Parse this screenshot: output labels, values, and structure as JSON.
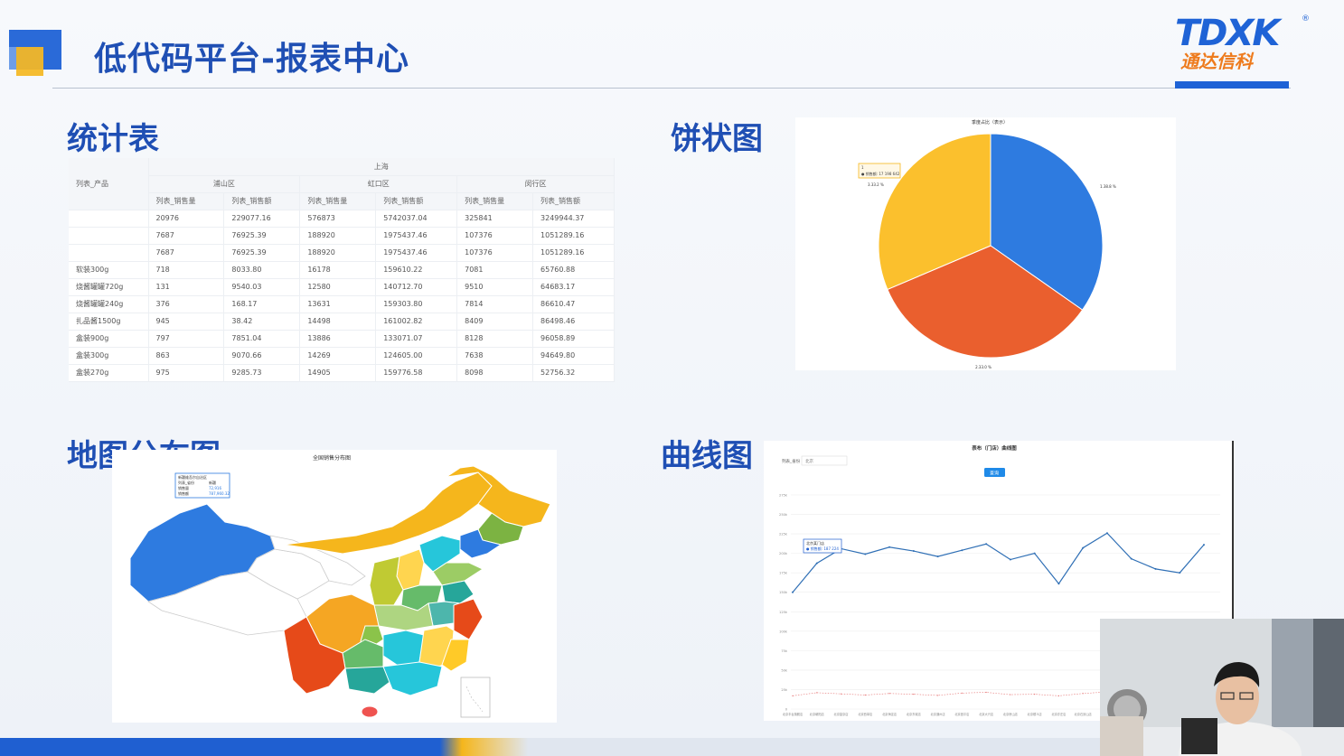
{
  "header": {
    "title": "低代码平台-报表中心",
    "logo_text": "TDXK",
    "logo_reg": "®",
    "logo_cn": "通达信科"
  },
  "sections": {
    "table_title": "统计表",
    "pie_title": "饼状图",
    "map_title": "地图分布图",
    "line_title": "曲线图"
  },
  "table": {
    "group_header": "上海",
    "row_header": "列表_产品",
    "districts": [
      "浦山区",
      "虹口区",
      "闵行区"
    ],
    "sub_headers": [
      "列表_销售量",
      "列表_销售额",
      "列表_销售量",
      "列表_销售额",
      "列表_销售量",
      "列表_销售额"
    ],
    "rows": [
      [
        "",
        "20976",
        "229077.16",
        "576873",
        "5742037.04",
        "325841",
        "3249944.37"
      ],
      [
        "",
        "7687",
        "76925.39",
        "188920",
        "1975437.46",
        "107376",
        "1051289.16"
      ],
      [
        "",
        "7687",
        "76925.39",
        "188920",
        "1975437.46",
        "107376",
        "1051289.16"
      ],
      [
        "软装300g",
        "718",
        "8033.80",
        "16178",
        "159610.22",
        "7081",
        "65760.88"
      ],
      [
        "烧酱罐罐720g",
        "131",
        "9540.03",
        "12580",
        "140712.70",
        "9510",
        "64683.17"
      ],
      [
        "烧酱罐罐240g",
        "376",
        "168.17",
        "13631",
        "159303.80",
        "7814",
        "86610.47"
      ],
      [
        "扎品酱1500g",
        "945",
        "38.42",
        "14498",
        "161002.82",
        "8409",
        "86498.46"
      ],
      [
        "盒装900g",
        "797",
        "7851.04",
        "13886",
        "133071.07",
        "8128",
        "96058.89"
      ],
      [
        "盒装300g",
        "863",
        "9070.66",
        "14269",
        "124605.00",
        "7638",
        "94649.80"
      ],
      [
        "盒装270g",
        "975",
        "9285.73",
        "14905",
        "159776.58",
        "8098",
        "52756.32"
      ]
    ]
  },
  "pie": {
    "title": "季度占比（表示）",
    "tooltip_line1": "1",
    "tooltip_line2": "● 销售额: 17 198 642",
    "labels": [
      "1.38.8 %",
      "2.33.0 %",
      "3.33.2 %"
    ],
    "colors": [
      "#2e7be0",
      "#ea5f2e",
      "#fbc02d"
    ]
  },
  "map": {
    "title": "全国销售分布图",
    "tooltip": {
      "title": "新疆维吾尔自治区",
      "rows": [
        [
          "列表_省份",
          "新疆"
        ],
        [
          "销售量",
          "72,916"
        ],
        [
          "销售额",
          "787,960.32"
        ]
      ]
    }
  },
  "line": {
    "title": "表布（门店）曲线图",
    "filter_label": "列表_省份",
    "filter_value": "北京",
    "query_button": "查询",
    "tooltip_title": "北京某门店",
    "tooltip_value": "● 销售额: 187 224",
    "y_ticks": [
      "275k",
      "250k",
      "225k",
      "200k",
      "175k",
      "150k",
      "125k",
      "100k",
      "75k",
      "50k",
      "25k",
      "0"
    ]
  },
  "chart_data": {
    "type": "line",
    "title": "表布（门店）曲线图",
    "xlabel": "",
    "ylabel": "",
    "ylim": [
      0,
      275000
    ],
    "categories": [
      "北京丰台旗舰店",
      "北京朝阳店",
      "北京望京店",
      "北京西单店",
      "北京海淀店",
      "北京东城店",
      "北京通州店",
      "北京昌平店",
      "北京大兴店",
      "北京房山店",
      "北京顺义店",
      "北京亦庄店",
      "北京石景山店",
      "北京怀柔店",
      "北京延庆店",
      "北京密云店",
      "北京平谷店",
      "北京门头沟店"
    ],
    "series": [
      {
        "values": [
          150000,
          187224,
          206000,
          199000,
          208000,
          203000,
          196000,
          204000,
          212000,
          192000,
          200000,
          161000,
          207000,
          226000,
          193000,
          180000,
          175000,
          211000
        ]
      },
      {
        "values": [
          17000,
          21000,
          19500,
          18000,
          20000,
          19000,
          17500,
          20500,
          21500,
          18500,
          19000,
          17000,
          20000,
          22000,
          18000,
          17500,
          17000,
          20000
        ]
      }
    ]
  }
}
